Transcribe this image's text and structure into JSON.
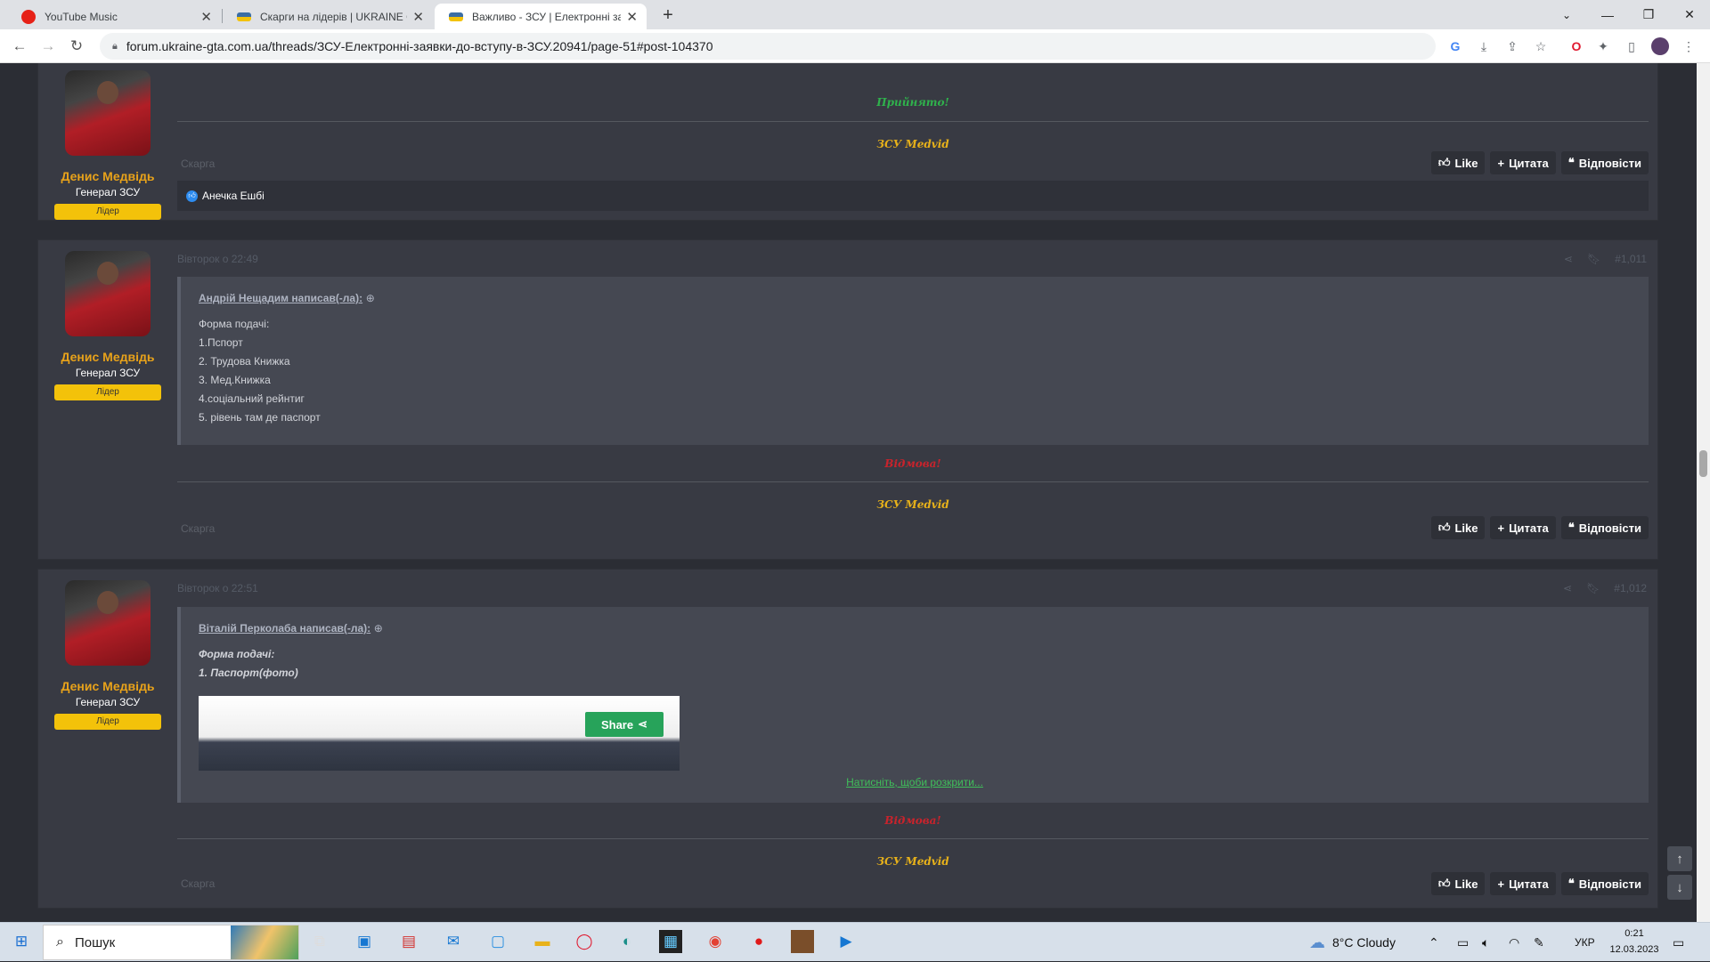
{
  "browser": {
    "tabs": [
      {
        "title": "YouTube Music",
        "active": false,
        "color": "#e62117"
      },
      {
        "title": "Скарги на лідерів | UKRAINE GTA",
        "active": false,
        "color": "#3b6ea5"
      },
      {
        "title": "Важливо - ЗСУ | Електронні заяв",
        "active": true,
        "color": "#3b6ea5"
      }
    ],
    "new_tab": "+",
    "url": "forum.ukraine-gta.com.ua/threads/ЗСУ-Електронні-заявки-до-вступу-в-ЗСУ.20941/page-51#post-104370"
  },
  "posts": [
    {
      "user": {
        "name": "Денис Медвідь",
        "title": "Генерал ЗСУ",
        "badge": "Лідер"
      },
      "status_text": "Прийнято!",
      "status_color": "#2fb24c",
      "signature": "ЗСУ Medvid",
      "report": "Скарга",
      "actions": {
        "like": "Like",
        "quote": "Цитата",
        "reply": "Відповісти"
      },
      "likes": "Анечка Ешбі"
    },
    {
      "user": {
        "name": "Денис Медвідь",
        "title": "Генерал ЗСУ",
        "badge": "Лідер"
      },
      "date": "Вівторок о 22:49",
      "number": "#1,011",
      "quote_author": "Андрій Нещадим написав(-ла):",
      "quote_lines": [
        "Форма подачі:",
        "1.Пспорт",
        "2. Трудова Книжка",
        "3. Мед.Книжка",
        "4.соціальний рейнтиг",
        "5. рівень там де паспорт"
      ],
      "status_text": "Відмова!",
      "status_color": "#c8232c",
      "signature": "ЗСУ Medvid",
      "report": "Скарга",
      "actions": {
        "like": "Like",
        "quote": "Цитата",
        "reply": "Відповісти"
      }
    },
    {
      "user": {
        "name": "Денис Медвідь",
        "title": "Генерал ЗСУ",
        "badge": "Лідер"
      },
      "date": "Вівторок о 22:51",
      "number": "#1,012",
      "quote_author": "Віталій Перколаба написав(-ла):",
      "quote_lines": [
        "Форма подачі:",
        "1. Паспорт(фото)"
      ],
      "share_label": "Share",
      "expand_link": "Натисніть, щоби розкрити...",
      "status_text": "Відмова!",
      "status_color": "#c8232c",
      "signature": "ЗСУ Medvid",
      "report": "Скарга",
      "actions": {
        "like": "Like",
        "quote": "Цитата",
        "reply": "Відповісти"
      }
    }
  ],
  "signature_color": "#e8b21a",
  "taskbar": {
    "search_placeholder": "Пошук",
    "weather": "8°C  Cloudy",
    "lang": "УКР",
    "time": "0:21",
    "date": "12.03.2023"
  }
}
